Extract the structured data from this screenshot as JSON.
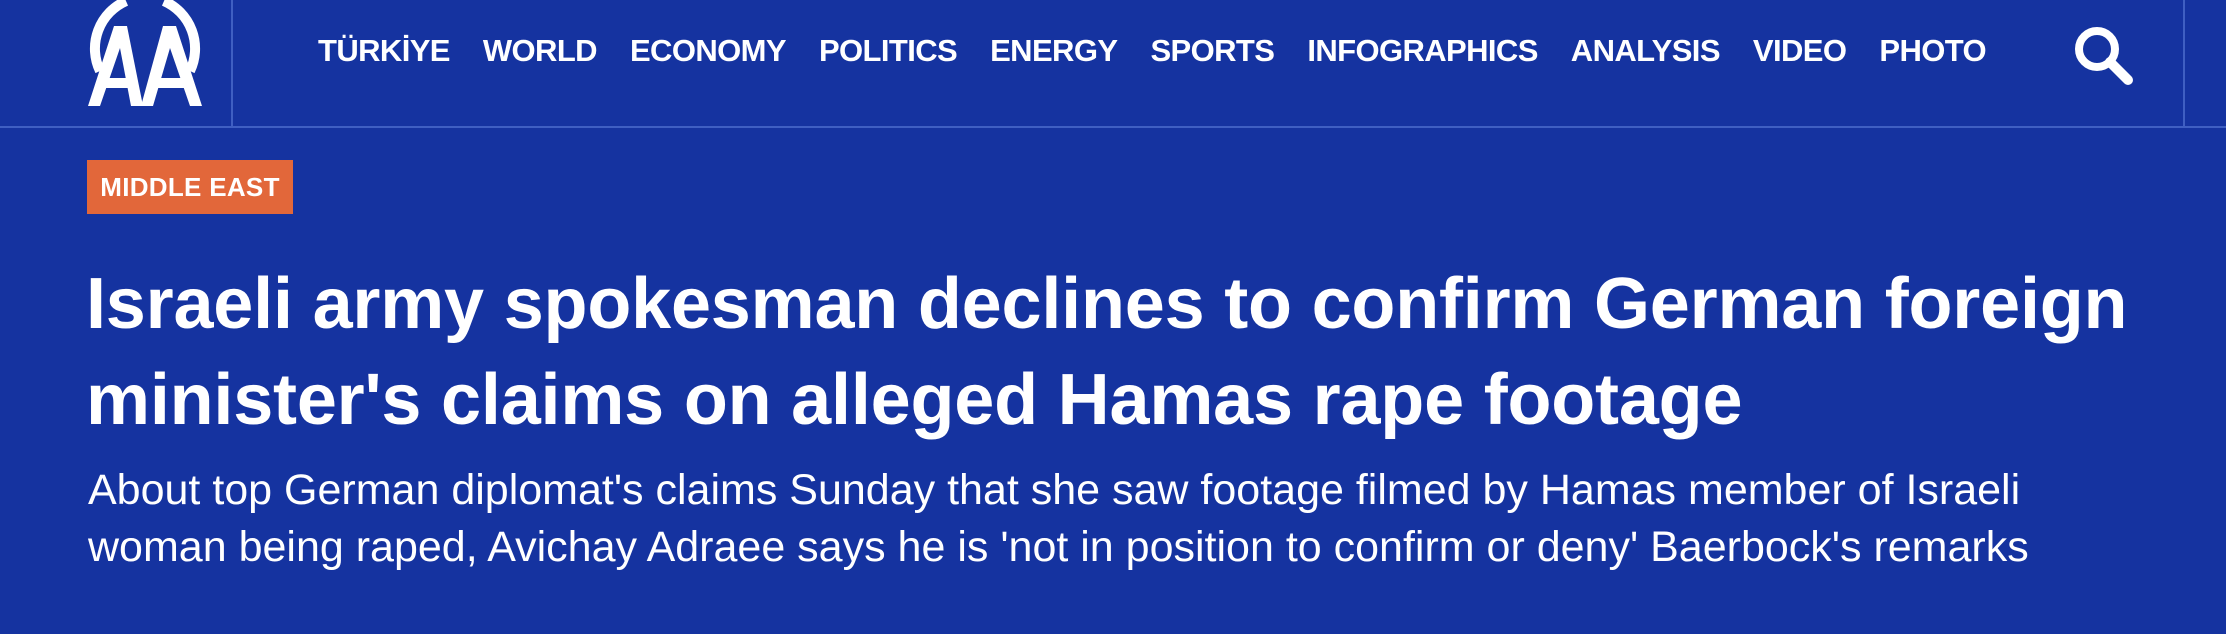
{
  "site": {
    "logo_text": "AA"
  },
  "nav": {
    "items": [
      {
        "label": "TÜRKİYE"
      },
      {
        "label": "WORLD"
      },
      {
        "label": "ECONOMY"
      },
      {
        "label": "POLITICS"
      },
      {
        "label": "ENERGY"
      },
      {
        "label": "SPORTS"
      },
      {
        "label": "INFOGRAPHICS"
      },
      {
        "label": "ANALYSIS"
      },
      {
        "label": "VIDEO"
      },
      {
        "label": "PHOTO"
      }
    ],
    "search_icon": "search-icon"
  },
  "article": {
    "category": "MIDDLE EAST",
    "headline": "Israeli army spokesman declines to confirm German foreign minister's claims on alleged Hamas rape footage",
    "summary": "About top German diplomat's claims Sunday that she saw footage filmed by Hamas member of Israeli woman being raped, Avichay Adraee says he is 'not in position to confirm or deny' Baerbock's remarks"
  },
  "colors": {
    "background": "#1533a0",
    "badge": "#e2673a",
    "divider": "#3f5fc2",
    "text": "#ffffff"
  }
}
